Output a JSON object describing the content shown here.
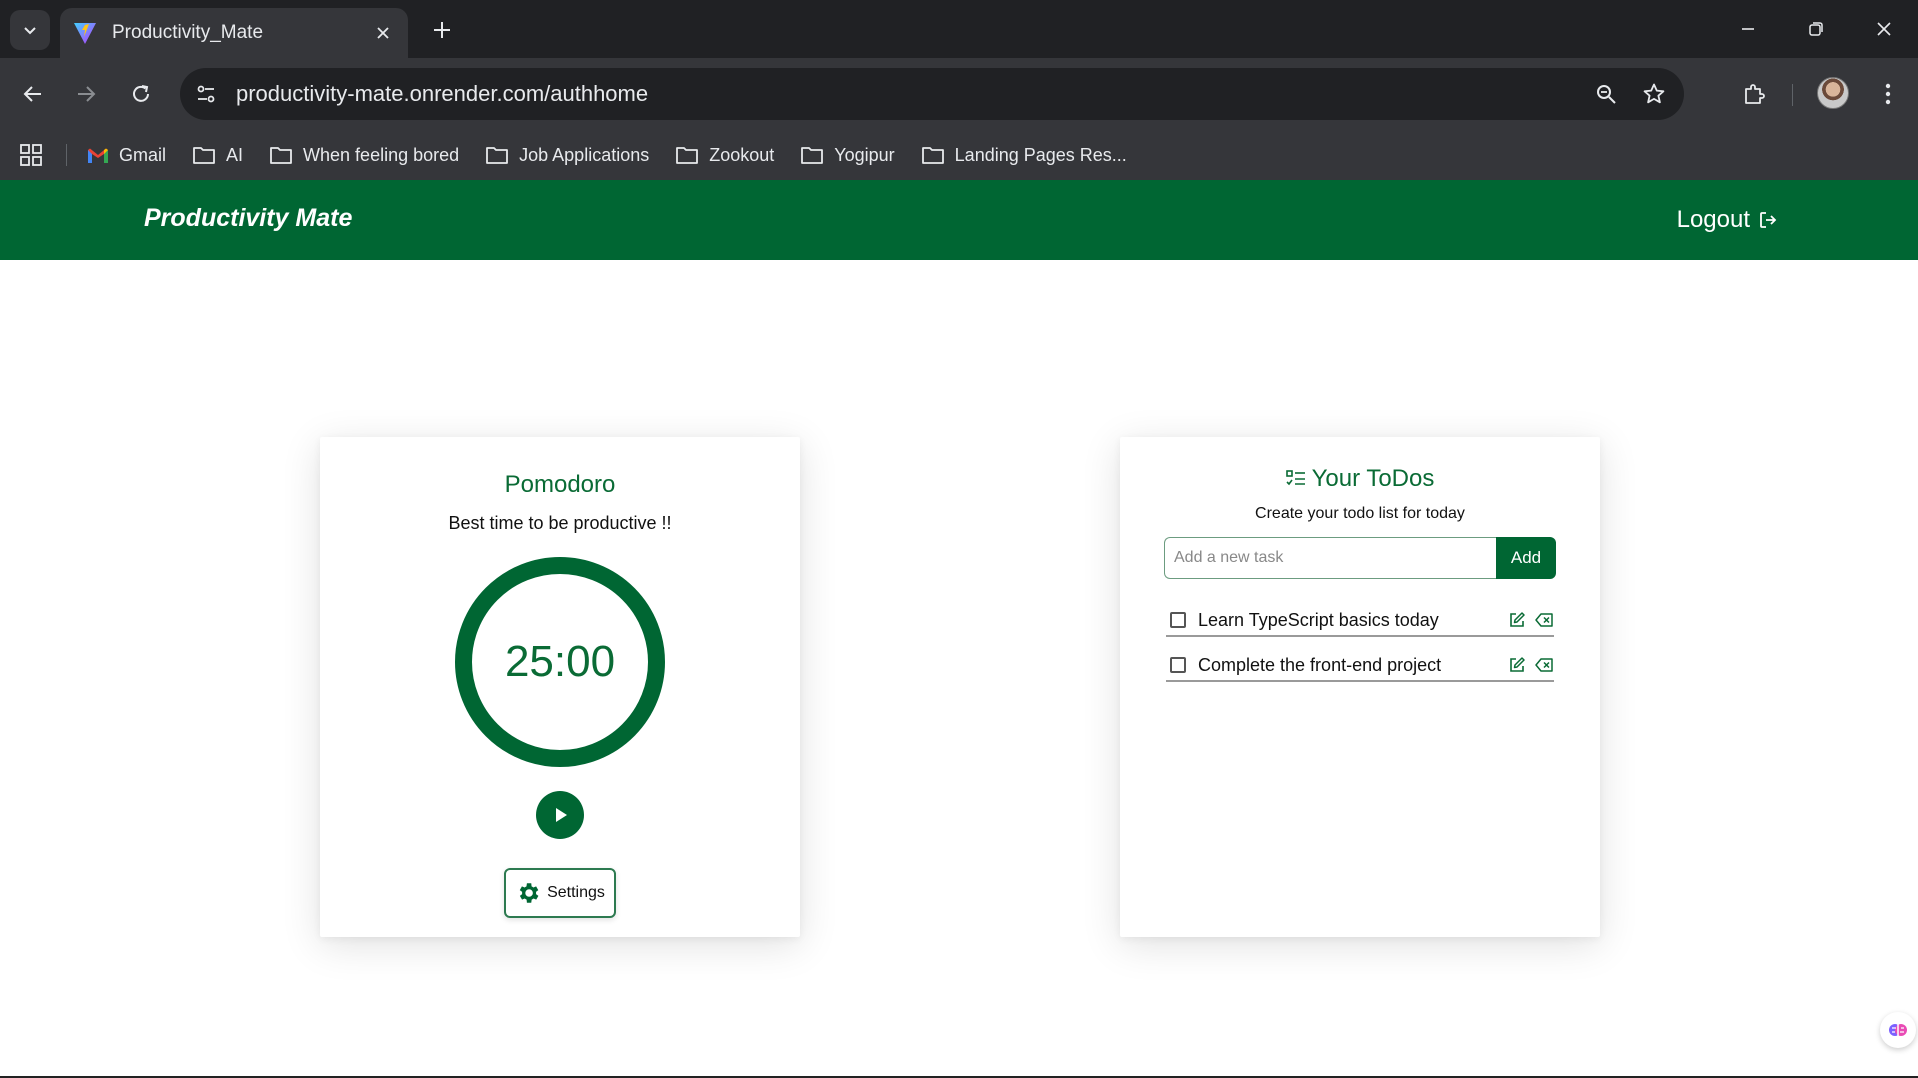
{
  "browser": {
    "tab_title": "Productivity_Mate",
    "url": "productivity-mate.onrender.com/authhome",
    "bookmarks": [
      {
        "label": "Gmail",
        "icon": "gmail-icon"
      },
      {
        "label": "AI",
        "icon": "folder-icon"
      },
      {
        "label": "When feeling bored",
        "icon": "folder-icon"
      },
      {
        "label": "Job Applications",
        "icon": "folder-icon"
      },
      {
        "label": "Zookout",
        "icon": "folder-icon"
      },
      {
        "label": "Yogipur",
        "icon": "folder-icon"
      },
      {
        "label": "Landing Pages Res...",
        "icon": "folder-icon"
      }
    ]
  },
  "app": {
    "brand": "Productivity Mate",
    "logout_label": "Logout",
    "accent_color": "#006633"
  },
  "pomodoro": {
    "title": "Pomodoro",
    "subtitle": "Best time to be productive !!",
    "time": "25:00",
    "settings_label": "Settings"
  },
  "todos": {
    "title": "Your ToDos",
    "subtitle": "Create your todo list for today",
    "input_placeholder": "Add a new task",
    "add_label": "Add",
    "items": [
      {
        "text": "Learn TypeScript basics today",
        "done": false
      },
      {
        "text": "Complete the front-end project",
        "done": false
      }
    ]
  }
}
